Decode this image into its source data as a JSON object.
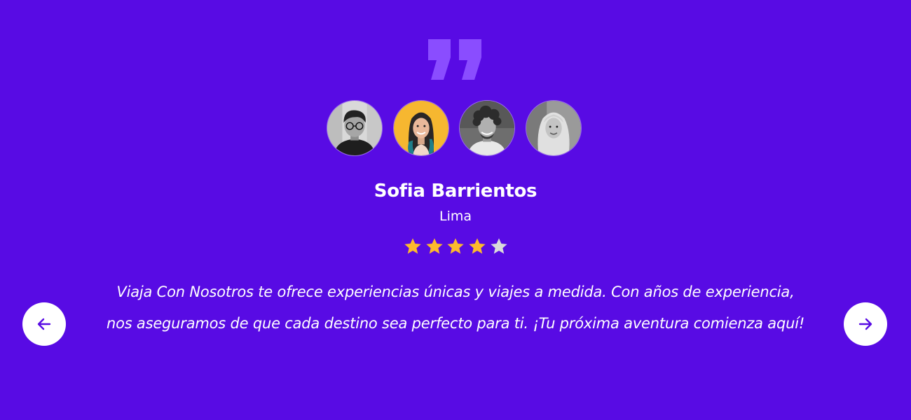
{
  "colors": {
    "background": "#580BE4",
    "quote_mark": "#8A4DFF",
    "star_filled": "#FDBA2C",
    "star_empty": "#DADADA",
    "button_bg": "#FFFFFF",
    "button_icon": "#580BE4"
  },
  "quote_icon": "quote-icon",
  "avatars": [
    {
      "icon": "avatar-man-glasses",
      "tint": "grayscale"
    },
    {
      "icon": "avatar-woman-yellow",
      "tint": "color",
      "active": true
    },
    {
      "icon": "avatar-man-curly",
      "tint": "grayscale"
    },
    {
      "icon": "avatar-woman-hijab",
      "tint": "grayscale"
    }
  ],
  "testimonial": {
    "name": "Sofia Barrientos",
    "location": "Lima",
    "rating": 4,
    "rating_max": 5,
    "text": "Viaja Con Nosotros te ofrece experiencias únicas y viajes a medida. Con años de experiencia, nos aseguramos de que cada destino sea perfecto para ti. ¡Tu próxima aventura comienza aquí!"
  },
  "navigation": {
    "prev_icon": "arrow-left-icon",
    "next_icon": "arrow-right-icon"
  }
}
